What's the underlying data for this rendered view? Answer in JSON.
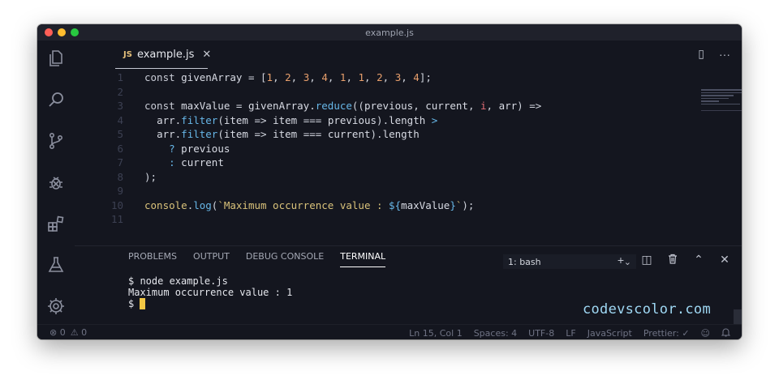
{
  "window": {
    "title": "example.js"
  },
  "tab": {
    "icon_text": "JS",
    "name": "example.js",
    "close": "✕"
  },
  "tab_actions": {
    "split": "▯",
    "more": "···"
  },
  "editor": {
    "lines": [
      {
        "n": "1",
        "tokens": [
          [
            "kw",
            "const "
          ],
          [
            "var",
            "givenArray "
          ],
          [
            "op",
            "= ["
          ],
          [
            "num",
            "1"
          ],
          [
            "op",
            ", "
          ],
          [
            "num",
            "2"
          ],
          [
            "op",
            ", "
          ],
          [
            "num",
            "3"
          ],
          [
            "op",
            ", "
          ],
          [
            "num",
            "4"
          ],
          [
            "op",
            ", "
          ],
          [
            "num",
            "1"
          ],
          [
            "op",
            ", "
          ],
          [
            "num",
            "1"
          ],
          [
            "op",
            ", "
          ],
          [
            "num",
            "2"
          ],
          [
            "op",
            ", "
          ],
          [
            "num",
            "3"
          ],
          [
            "op",
            ", "
          ],
          [
            "num",
            "4"
          ],
          [
            "op",
            "];"
          ]
        ]
      },
      {
        "n": "2",
        "tokens": []
      },
      {
        "n": "3",
        "tokens": [
          [
            "kw",
            "const "
          ],
          [
            "var",
            "maxValue "
          ],
          [
            "op",
            "= "
          ],
          [
            "var",
            "givenArray."
          ],
          [
            "fn",
            "reduce"
          ],
          [
            "op",
            "(("
          ],
          [
            "var",
            "previous"
          ],
          [
            "op",
            ", "
          ],
          [
            "var",
            "current"
          ],
          [
            "op",
            ", "
          ],
          [
            "param",
            "i"
          ],
          [
            "op",
            ", "
          ],
          [
            "var",
            "arr"
          ],
          [
            "op",
            ") =>"
          ]
        ]
      },
      {
        "n": "4",
        "tokens": [
          [
            "op",
            "  "
          ],
          [
            "var",
            "arr."
          ],
          [
            "fn",
            "filter"
          ],
          [
            "op",
            "("
          ],
          [
            "var",
            "item "
          ],
          [
            "op",
            "=> "
          ],
          [
            "var",
            "item "
          ],
          [
            "op",
            "=== "
          ],
          [
            "var",
            "previous"
          ],
          [
            "op",
            ")."
          ],
          [
            "var",
            "length "
          ],
          [
            "fn",
            ">"
          ]
        ]
      },
      {
        "n": "5",
        "tokens": [
          [
            "op",
            "  "
          ],
          [
            "var",
            "arr."
          ],
          [
            "fn",
            "filter"
          ],
          [
            "op",
            "("
          ],
          [
            "var",
            "item "
          ],
          [
            "op",
            "=> "
          ],
          [
            "var",
            "item "
          ],
          [
            "op",
            "=== "
          ],
          [
            "var",
            "current"
          ],
          [
            "op",
            ")."
          ],
          [
            "var",
            "length"
          ]
        ]
      },
      {
        "n": "6",
        "tokens": [
          [
            "op",
            "    "
          ],
          [
            "fn",
            "? "
          ],
          [
            "var",
            "previous"
          ]
        ]
      },
      {
        "n": "7",
        "tokens": [
          [
            "op",
            "    "
          ],
          [
            "fn",
            ": "
          ],
          [
            "var",
            "current"
          ]
        ]
      },
      {
        "n": "8",
        "tokens": [
          [
            "op",
            ");"
          ]
        ]
      },
      {
        "n": "9",
        "tokens": []
      },
      {
        "n": "10",
        "tokens": [
          [
            "str",
            "console"
          ],
          [
            "op",
            "."
          ],
          [
            "fn",
            "log"
          ],
          [
            "op",
            "("
          ],
          [
            "str",
            "`Maximum occurrence value : "
          ],
          [
            "fn",
            "${"
          ],
          [
            "var",
            "maxValue"
          ],
          [
            "fn",
            "}"
          ],
          [
            "str",
            "`"
          ],
          [
            "op",
            ");"
          ]
        ]
      },
      {
        "n": "11",
        "tokens": []
      }
    ]
  },
  "panel": {
    "tabs": [
      "PROBLEMS",
      "OUTPUT",
      "DEBUG CONSOLE",
      "TERMINAL"
    ],
    "active_tab": "TERMINAL",
    "terminal_select": "1: bash",
    "actions": {
      "add": "+",
      "split": "◫",
      "trash": "🗑",
      "maximize": "⌃",
      "close": "✕"
    }
  },
  "terminal": {
    "lines": [
      "$ node example.js",
      "Maximum occurrence value : 1"
    ],
    "prompt": "$ "
  },
  "watermark": "codevscolor.com",
  "status": {
    "errors": "0",
    "warnings": "0",
    "position": "Ln 15, Col 1",
    "spaces": "Spaces: 4",
    "encoding": "UTF-8",
    "eol": "LF",
    "language": "JavaScript",
    "prettier": "Prettier: ✓"
  },
  "colors": {
    "background": "#14161f",
    "accent_cursor": "#f2c744",
    "number": "#e89f6c",
    "function": "#67b7e8",
    "string": "#d9c27a",
    "watermark": "#9fd8f4"
  }
}
